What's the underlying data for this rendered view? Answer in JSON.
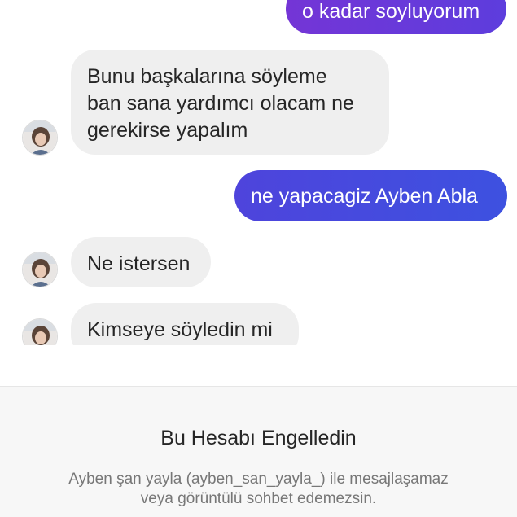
{
  "messages": [
    {
      "from": "me",
      "text": "o kadar soyluyorum"
    },
    {
      "from": "them",
      "lines": [
        "Bunu başkalarına söyleme",
        "ban sana yardımcı olacam ne",
        "gerekirse yapalım"
      ]
    },
    {
      "from": "me",
      "text": "ne yapacagiz Ayben Abla"
    },
    {
      "from": "them",
      "text": "Ne istersen"
    },
    {
      "from": "them",
      "text": "Kimseye söyledin mi"
    }
  ],
  "blocked_notice": {
    "title": "Bu Hesabı Engelledin",
    "description_line1": "Ayben şan yayla (ayben_san_yayla_) ile mesajlaşamaz",
    "description_line2": "veya görüntülü sohbet edemezsin."
  },
  "colors": {
    "sent_gradient_start": "#6b35d8",
    "sent_gradient_end": "#3d51e0",
    "received_bubble": "#efefef"
  }
}
